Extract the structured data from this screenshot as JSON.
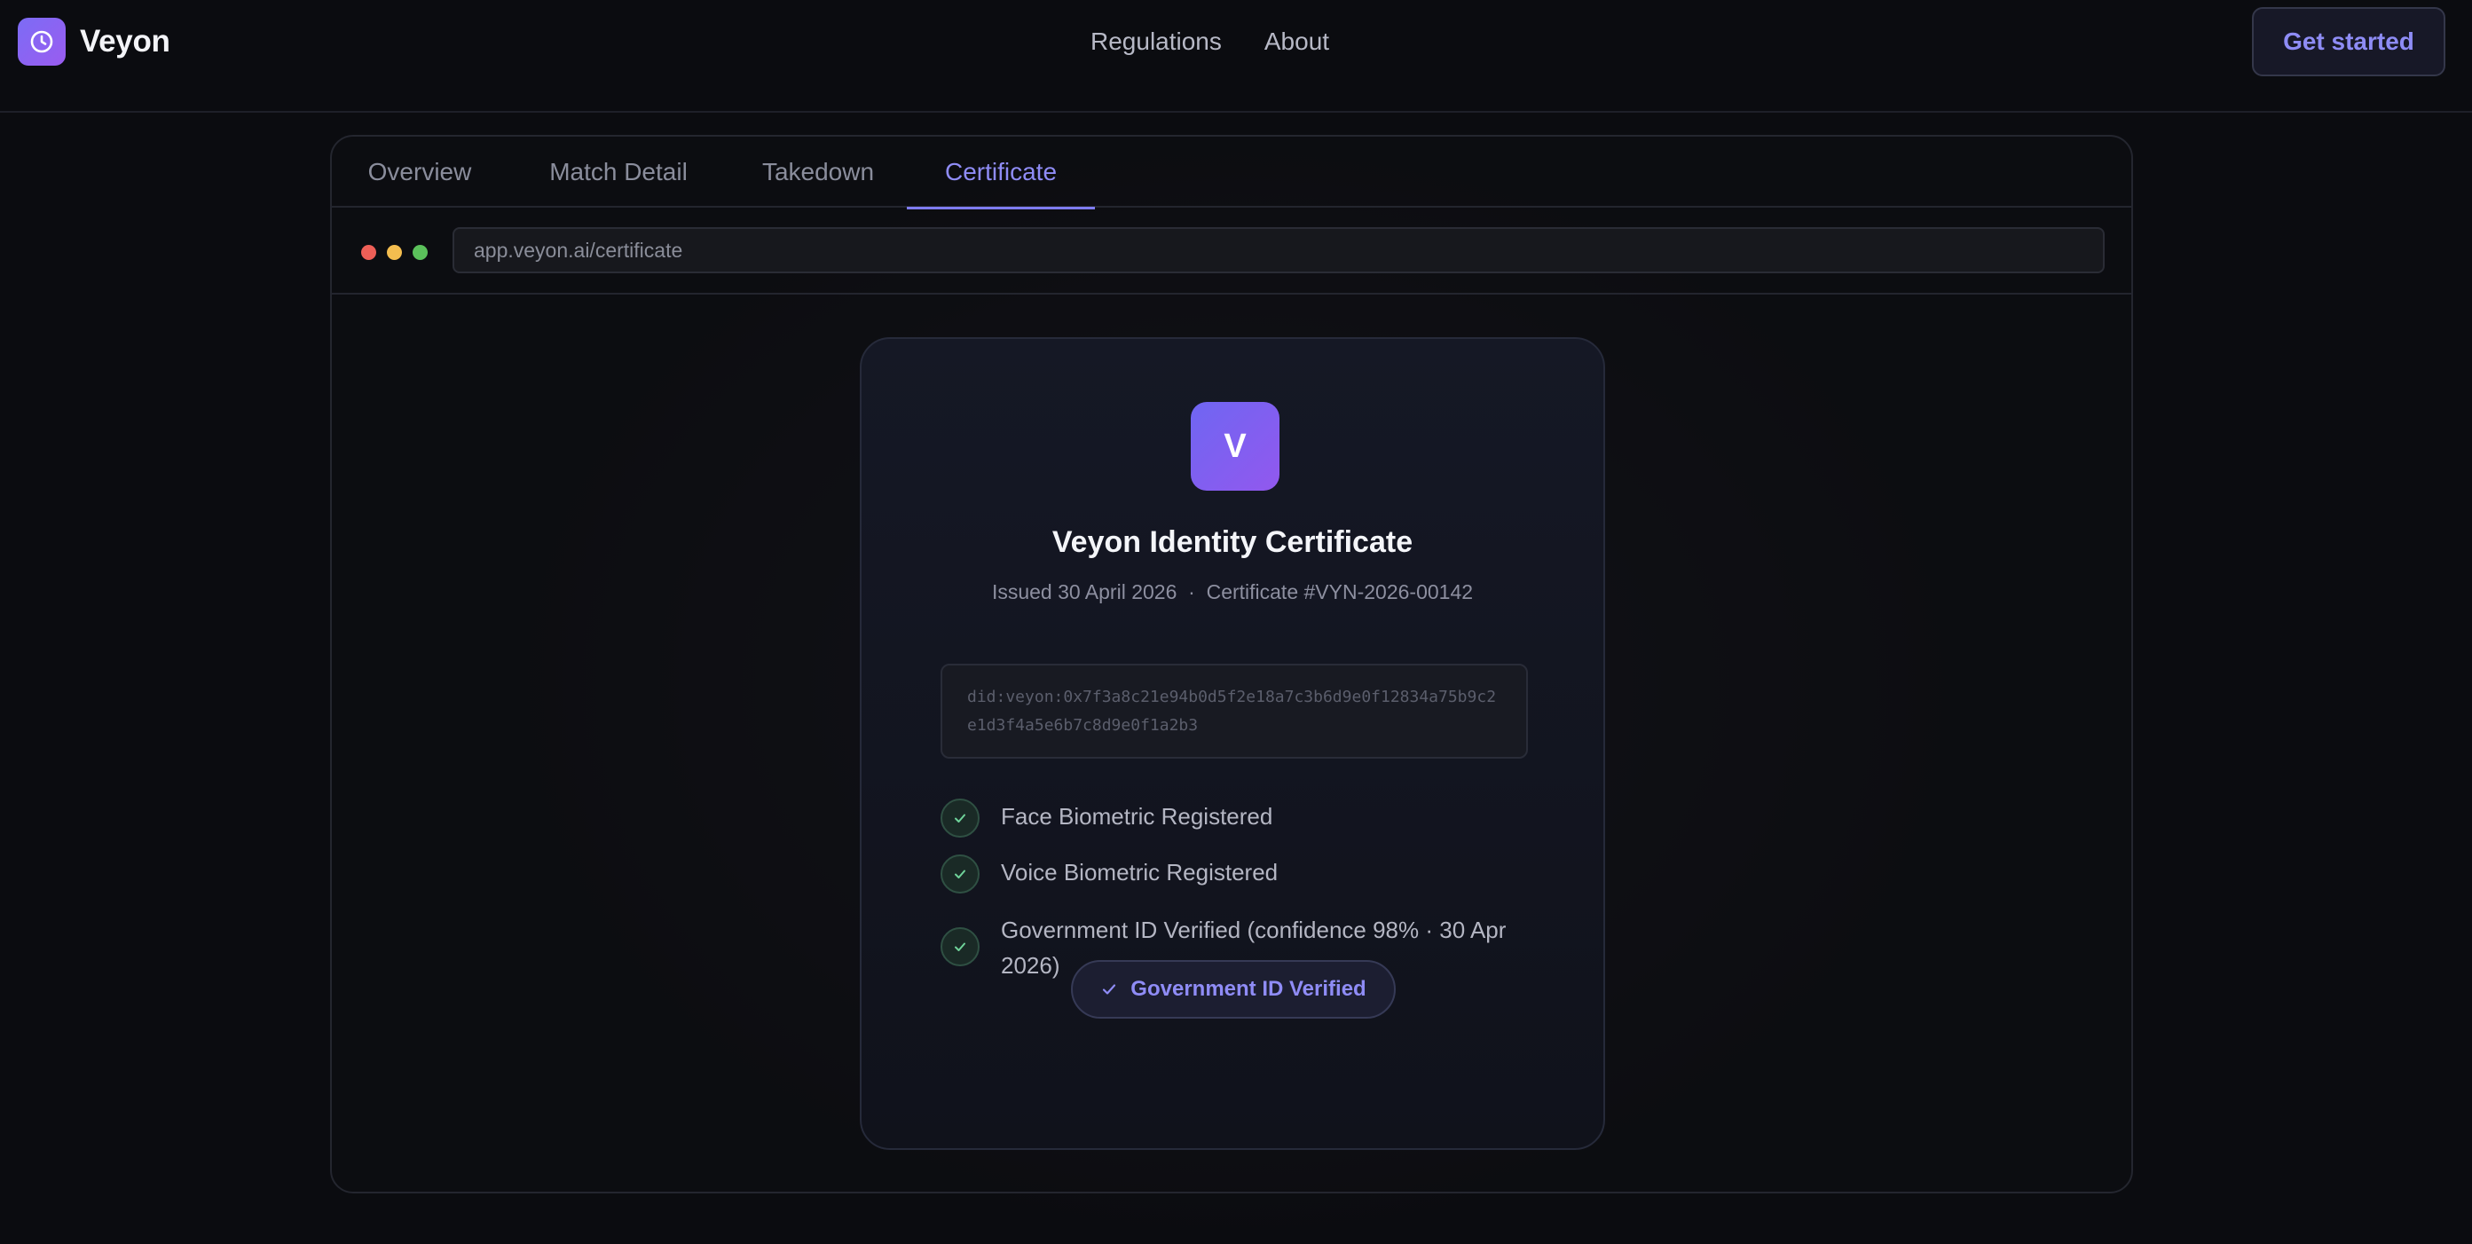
{
  "nav": {
    "brand_name": "Veyon",
    "links": [
      "Regulations",
      "About"
    ],
    "cta_label": "Get started"
  },
  "tabs": [
    {
      "label": "Overview",
      "active": false
    },
    {
      "label": "Match Detail",
      "active": false
    },
    {
      "label": "Takedown",
      "active": false
    },
    {
      "label": "Certificate",
      "active": true
    }
  ],
  "browser": {
    "url": "app.veyon.ai/certificate"
  },
  "certificate": {
    "logo_letter": "V",
    "title": "Veyon Identity Certificate",
    "meta": "Issued 30 April 2026  ·  Certificate #VYN-2026-00142",
    "did": "did:veyon:0x7f3a8c21e94b0d5f2e18a7c3b6d9e0f12834a75b9c2e1d3f4a5e6b7c8d9e0f1a2b3",
    "checks": [
      {
        "label": "Face Biometric Registered"
      },
      {
        "label": "Voice Biometric Registered"
      },
      {
        "label": "Government ID Verified  (confidence 98% · 30 Apr 2026)"
      }
    ],
    "status_badge": "Government ID Verified"
  },
  "colors": {
    "accent": "#8f8cf6",
    "brand_gradient_start": "#7c6cf5",
    "brand_gradient_end": "#9a5cf0",
    "check_green": "#6fd39a",
    "background": "#0b0c10"
  },
  "icons": {
    "brand": "clock-icon",
    "check": "check-icon"
  }
}
